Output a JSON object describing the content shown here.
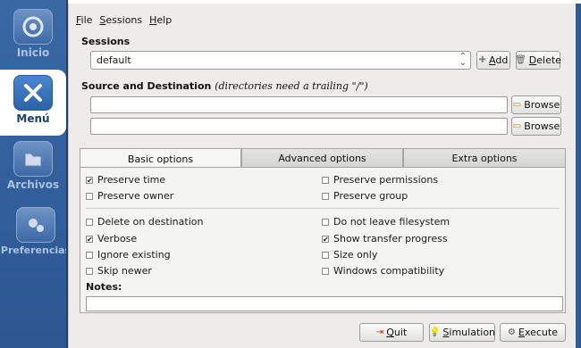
{
  "dock": {
    "items": [
      {
        "label": "Inicio",
        "icon": "home-icon"
      },
      {
        "label": "Menú",
        "icon": "tools-icon"
      },
      {
        "label": "Archivos",
        "icon": "folder-icon"
      },
      {
        "label": "Preferencias",
        "icon": "gear-icon"
      }
    ]
  },
  "menubar": {
    "file": {
      "acc": "F",
      "rest": "ile"
    },
    "sessions": {
      "acc": "S",
      "rest": "essions"
    },
    "help": {
      "acc": "H",
      "rest": "elp"
    }
  },
  "sessions": {
    "title": "Sessions",
    "selected": "default",
    "add_acc": "A",
    "add_rest": "dd",
    "delete_acc": "D",
    "delete_rest": "elete"
  },
  "source_dest": {
    "title": "Source and Destination",
    "hint": "(directories need a trailing \"/\")",
    "source_value": "",
    "dest_value": "",
    "browse_label": "Browse"
  },
  "tabs": {
    "items": [
      "Basic options",
      "Advanced options",
      "Extra options"
    ],
    "active": "Basic options"
  },
  "options": {
    "group1": [
      {
        "label": "Preserve time",
        "checked": true
      },
      {
        "label": "Preserve permissions",
        "checked": false
      },
      {
        "label": "Preserve owner",
        "checked": false
      },
      {
        "label": "Preserve group",
        "checked": false
      }
    ],
    "group2": [
      {
        "label": "Delete on destination",
        "checked": false
      },
      {
        "label": "Do not leave filesystem",
        "checked": false
      },
      {
        "label": "Verbose",
        "checked": true
      },
      {
        "label": "Show transfer progress",
        "checked": true
      },
      {
        "label": "Ignore existing",
        "checked": false
      },
      {
        "label": "Size only",
        "checked": false
      },
      {
        "label": "Skip newer",
        "checked": false
      },
      {
        "label": "Windows compatibility",
        "checked": false
      }
    ]
  },
  "notes": {
    "label": "Notes:",
    "value": ""
  },
  "footer": {
    "quit_acc": "Q",
    "quit_rest": "uit",
    "simulation_acc": "S",
    "simulation_rest": "imulation",
    "execute_acc": "E",
    "execute_rest": "xecute"
  },
  "colors": {
    "dock_bg": "#2f5a92",
    "active_dock": "#ffffff",
    "window_bg": "#edecea"
  }
}
